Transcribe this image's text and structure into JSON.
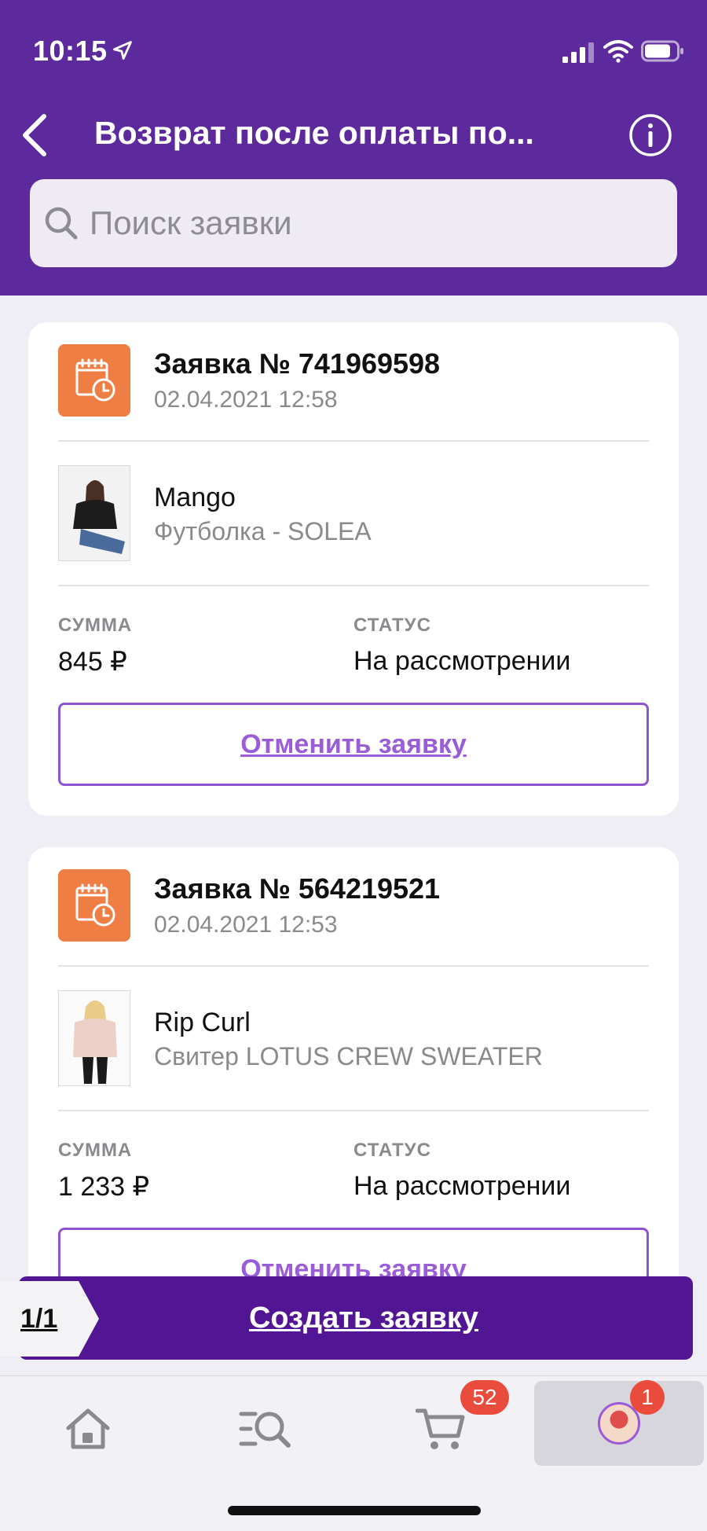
{
  "status_bar": {
    "time": "10:15"
  },
  "header": {
    "title": "Возврат после оплаты по..."
  },
  "search": {
    "placeholder": "Поиск заявки"
  },
  "labels": {
    "sum": "СУММА",
    "status": "СТАТУС"
  },
  "orders": [
    {
      "title": "Заявка № 741969598",
      "date": "02.04.2021 12:58",
      "brand": "Mango",
      "product": "Футболка - SOLEA",
      "sum": "845 ₽",
      "status": "На рассмотрении",
      "cancel_label": "Отменить заявку"
    },
    {
      "title": "Заявка № 564219521",
      "date": "02.04.2021 12:53",
      "brand": "Rip Curl",
      "product": "Свитер LOTUS CREW SWEATER",
      "sum": "1 233 ₽",
      "status": "На рассмотрении",
      "cancel_label": "Отменить заявку"
    }
  ],
  "bottom_action": {
    "pager": "1/1",
    "create_label": "Создать заявку"
  },
  "tabbar": {
    "items": [
      {
        "icon": "home-icon"
      },
      {
        "icon": "catalog-search-icon"
      },
      {
        "icon": "cart-icon",
        "badge": "52"
      },
      {
        "icon": "profile-avatar",
        "badge": "1"
      }
    ]
  },
  "colors": {
    "header": "#5c2a9c",
    "accent": "#9b5cd8",
    "order_icon": "#ef7e45",
    "badge": "#e94b3c",
    "action_bar": "#521594"
  }
}
